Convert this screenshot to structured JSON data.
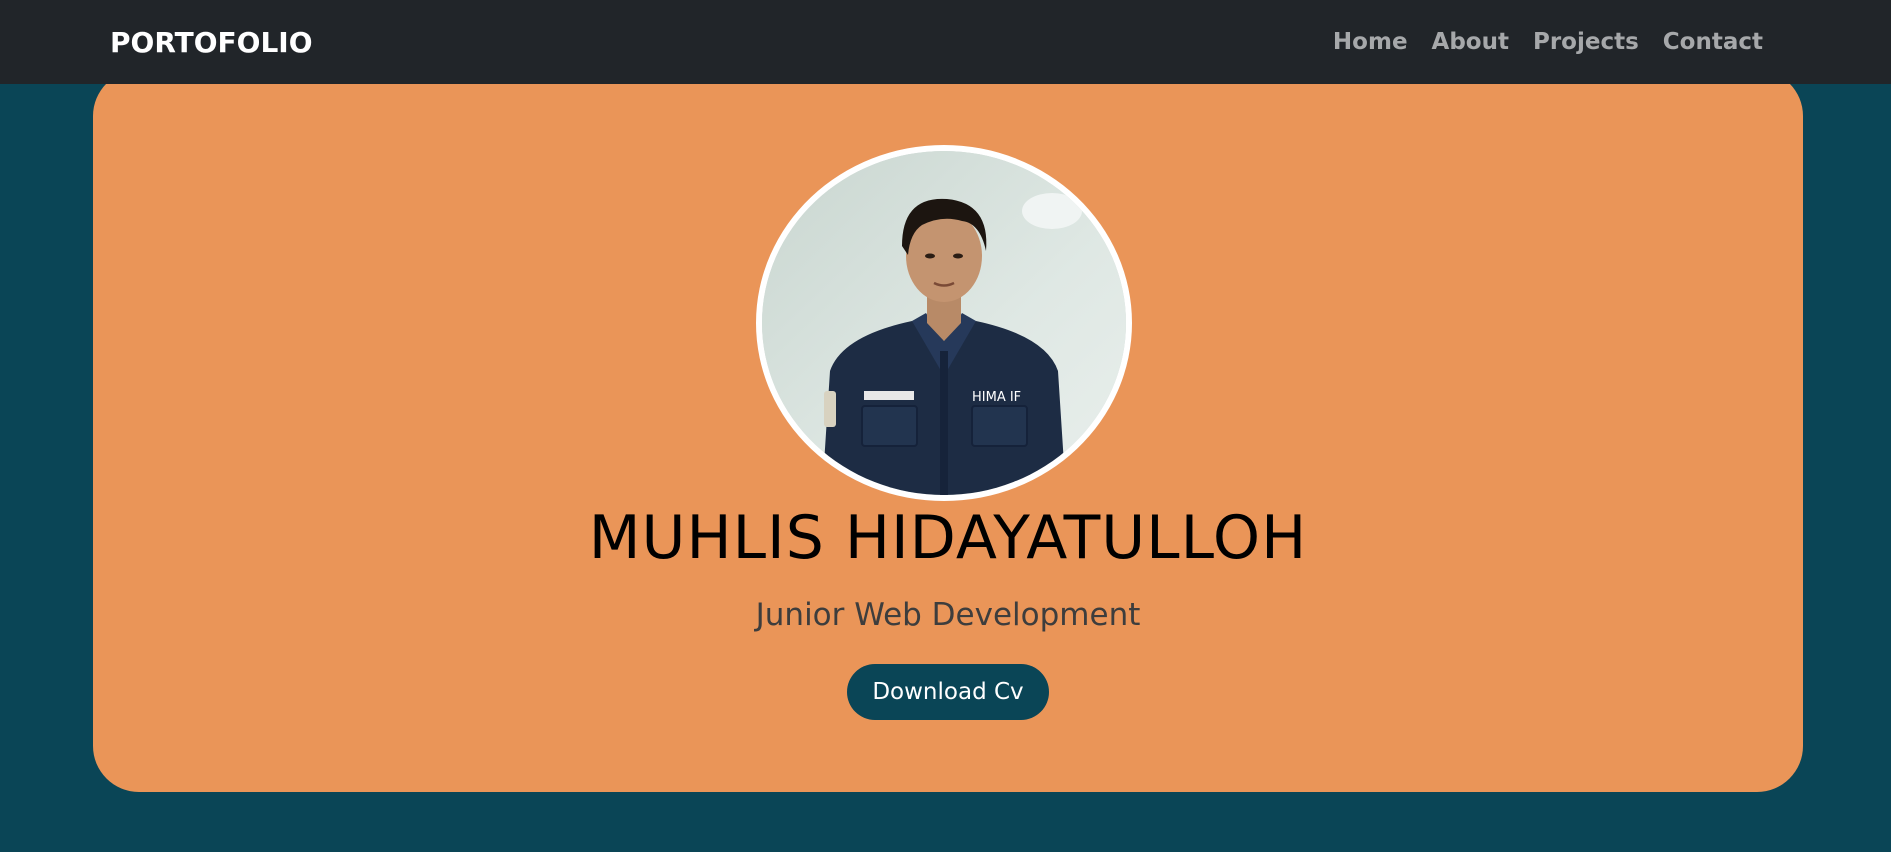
{
  "navbar": {
    "brand": "PORTOFOLIO",
    "links": [
      {
        "label": "Home"
      },
      {
        "label": "About"
      },
      {
        "label": "Projects"
      },
      {
        "label": "Contact"
      }
    ]
  },
  "hero": {
    "name": "MUHLIS HIDAYATULLOH",
    "role": "Junior Web Development",
    "cv_button": "Download Cv",
    "badge_text": "HIMA IF"
  },
  "colors": {
    "background": "#0a4556",
    "navbar": "#212529",
    "card": "#ea9558",
    "button": "#0a4556"
  }
}
